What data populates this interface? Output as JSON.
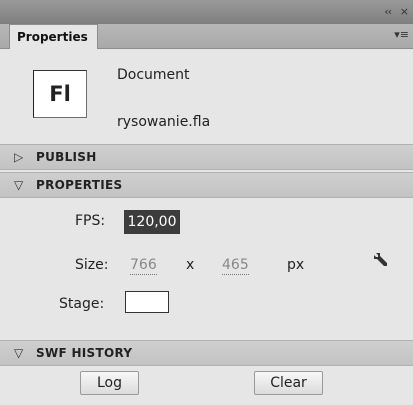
{
  "panel": {
    "collapse_glyph": "‹‹",
    "close_glyph": "×",
    "tab_label": "Properties",
    "tab_menu_glyph": "▾≡"
  },
  "document": {
    "icon_text": "Fl",
    "type_label": "Document",
    "filename": "rysowanie.fla"
  },
  "sections": {
    "publish": {
      "title": "PUBLISH",
      "arrow": "▷"
    },
    "properties": {
      "title": "PROPERTIES",
      "arrow": "▽"
    },
    "swf_history": {
      "title": "SWF HISTORY",
      "arrow": "▽"
    }
  },
  "properties": {
    "fps_label": "FPS:",
    "fps_value": "120,00",
    "size_label": "Size:",
    "width": "766",
    "x_sep": "x",
    "height": "465",
    "unit": "px",
    "stage_label": "Stage:",
    "stage_color": "#ffffff"
  },
  "history": {
    "log_label": "Log",
    "clear_label": "Clear"
  }
}
